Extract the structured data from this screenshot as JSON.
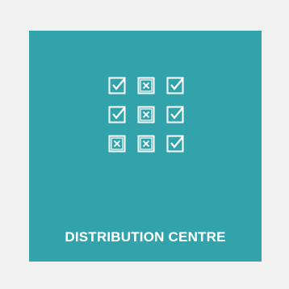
{
  "tile": {
    "label": "DISTRIBUTION CENTRE",
    "background_color": "#32a3ab",
    "foreground_color": "#ffffff",
    "icon": "checklist-grid-icon",
    "grid": [
      [
        "checked",
        "crossed",
        "checked"
      ],
      [
        "checked",
        "crossed",
        "checked"
      ],
      [
        "crossed",
        "crossed",
        "checked"
      ]
    ]
  },
  "page": {
    "background_color": "#f1f1f1"
  }
}
